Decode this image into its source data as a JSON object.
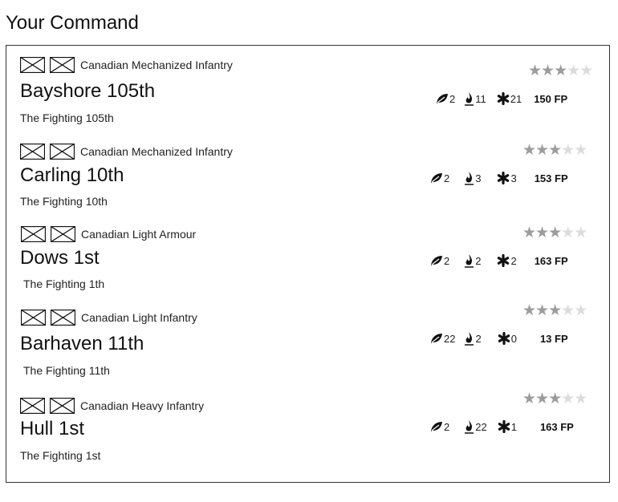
{
  "page": {
    "title": "Your Command"
  },
  "units": [
    {
      "type": "Canadian Mechanized Infantry",
      "name": "Bayshore 105th",
      "motto": "The Fighting 105th",
      "rating": 3,
      "rating_max": 5,
      "leaf": "2",
      "fire": "11",
      "asterisk": "21",
      "fp": "150 FP"
    },
    {
      "type": "Canadian Mechanized Infantry",
      "name": "Carling 10th",
      "motto": "The Fighting 10th",
      "rating": 3,
      "rating_max": 5,
      "leaf": "2",
      "fire": "3",
      "asterisk": "3",
      "fp": "153 FP"
    },
    {
      "type": "Canadian Light Armour",
      "name": "Dows 1st",
      "motto": "The Fighting 1th",
      "rating": 3,
      "rating_max": 5,
      "leaf": "2",
      "fire": "2",
      "asterisk": "2",
      "fp": "163 FP"
    },
    {
      "type": "Canadian Light Infantry",
      "name": "Barhaven 11th",
      "motto": "The Fighting 11th",
      "rating": 3,
      "rating_max": 5,
      "leaf": "22",
      "fire": "2",
      "asterisk": "0",
      "fp": "13 FP"
    },
    {
      "type": "Canadian Heavy Infantry",
      "name": "Hull 1st",
      "motto": "The Fighting 1st",
      "rating": 3,
      "rating_max": 5,
      "leaf": "2",
      "fire": "22",
      "asterisk": "1",
      "fp": "163 FP"
    }
  ],
  "icons": {
    "unit_symbol": "nato-infantry-symbol-icon",
    "leaf": "leaf-icon",
    "fire": "flame-icon",
    "asterisk": "asterisk-icon",
    "star": "star-icon"
  },
  "colors": {
    "star_on": "#9c9c9c",
    "star_off": "#dcdcdc",
    "border": "#333333"
  }
}
